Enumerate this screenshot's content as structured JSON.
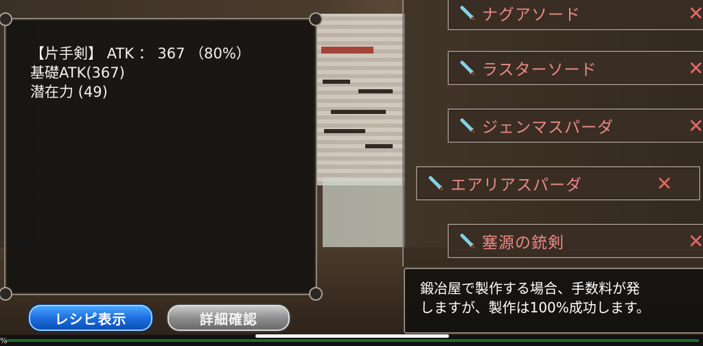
{
  "info_panel": {
    "lines": [
      "【片手剣】 ATK ： 367 （80%）",
      "基礎ATK(367)",
      "潜在力 (49)"
    ]
  },
  "buttons": {
    "recipe_label": "レシピ表示",
    "detail_label": "詳細確認"
  },
  "item_list": [
    {
      "name": "ナグアソード",
      "remove": "✕"
    },
    {
      "name": "ラスターソード",
      "remove": "✕"
    },
    {
      "name": "ジェンマスパーダ",
      "remove": "✕"
    },
    {
      "name": "エアリアスパーダ",
      "remove": "✕"
    },
    {
      "name": "塞源の銃剣",
      "remove": "✕"
    }
  ],
  "message": {
    "line1": "鍛冶屋で製作する場合、手数料が発",
    "line2": "しますが、製作は100%成功します。"
  },
  "status": {
    "percent_glyph": "%"
  },
  "colors": {
    "item_text": "#e98a86",
    "remove_icon": "#e46a64",
    "recipe_button": "#1d6fe0",
    "detail_button": "#8f8f8f"
  }
}
